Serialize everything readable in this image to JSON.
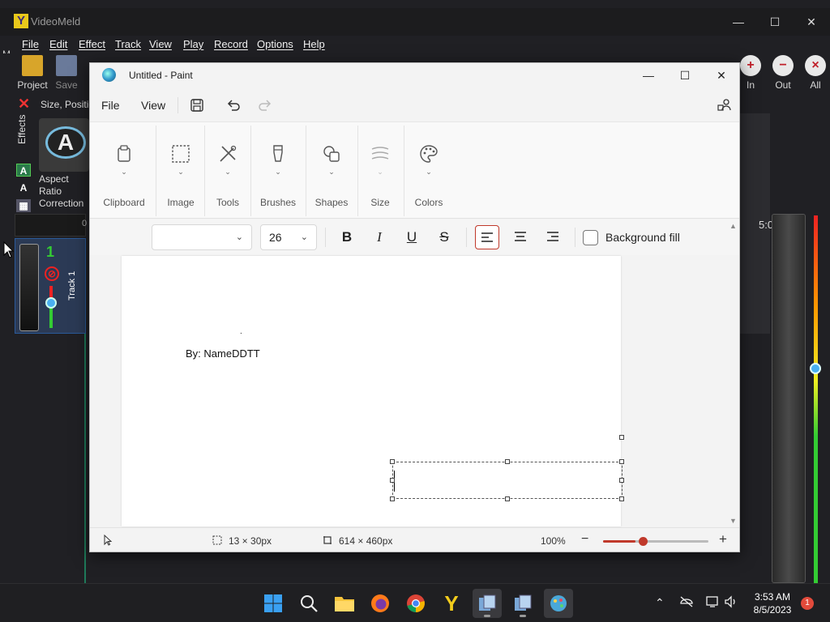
{
  "videomeld": {
    "title": "VideoMeld",
    "menu": [
      "File",
      "Edit",
      "Effect",
      "Track",
      "View",
      "Play",
      "Record",
      "Options",
      "Help"
    ],
    "toolbar": {
      "project": "Project",
      "save": "Save",
      "zoom_in": "In",
      "zoom_out": "Out",
      "zoom_all": "All"
    },
    "effects_label": "Effects",
    "size_position": "Size, Positio",
    "effect_name": "Aspect Ratio Correction",
    "track_number": "1",
    "track_name": "Track 1",
    "time_readout": "5:0",
    "stub_m": "M",
    "stub_0": "0"
  },
  "paint": {
    "title": "Untitled - Paint",
    "menu": {
      "file": "File",
      "view": "View"
    },
    "ribbon": [
      {
        "label": "Clipboard",
        "icon": "clipboard-icon"
      },
      {
        "label": "Image",
        "icon": "select-icon"
      },
      {
        "label": "Tools",
        "icon": "tools-icon"
      },
      {
        "label": "Brushes",
        "icon": "brush-icon"
      },
      {
        "label": "Shapes",
        "icon": "shapes-icon"
      },
      {
        "label": "Size",
        "icon": "size-icon"
      },
      {
        "label": "Colors",
        "icon": "palette-icon"
      }
    ],
    "text_toolbar": {
      "font_value": "",
      "font_size": "26",
      "background_fill": "Background fill"
    },
    "canvas": {
      "dot": ".",
      "byline": "By: NameDDTT"
    },
    "status": {
      "selection_size": "13 × 30px",
      "canvas_size": "614 × 460px",
      "zoom": "100%",
      "zoom_minus": "−",
      "zoom_plus": "+"
    },
    "accent_color": "#c0392b"
  },
  "taskbar": {
    "time": "3:53 AM",
    "date": "8/5/2023",
    "notifications": "1"
  }
}
